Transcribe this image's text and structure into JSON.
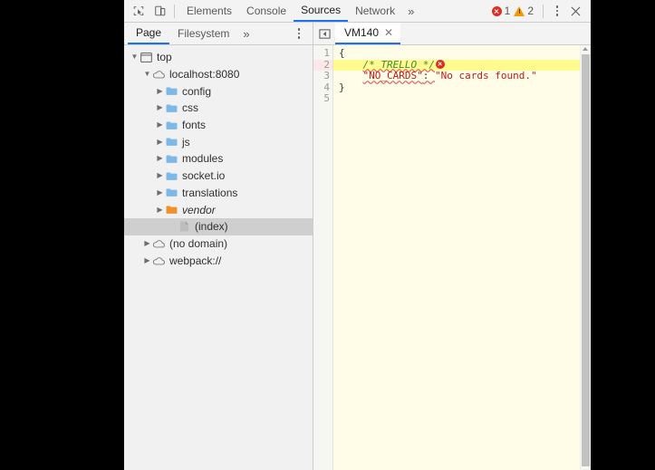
{
  "toolbar": {
    "inspect_icon": "inspect-cursor-icon",
    "device_icon": "device-toolbar-icon",
    "tabs": [
      {
        "label": "Elements",
        "active": false
      },
      {
        "label": "Console",
        "active": false
      },
      {
        "label": "Sources",
        "active": true
      },
      {
        "label": "Network",
        "active": false
      }
    ],
    "more_tabs_label": "»",
    "error_count": "1",
    "warning_count": "2",
    "menu_label": "⋮",
    "close_label": "✕"
  },
  "navigator": {
    "tabs": [
      {
        "label": "Page",
        "active": true
      },
      {
        "label": "Filesystem",
        "active": false
      }
    ],
    "more_tabs_label": "»",
    "menu_label": "⋮",
    "tree": [
      {
        "label": "top",
        "indent": 0,
        "twisty": "open",
        "icon": "frame-icon",
        "italic": false,
        "selected": false
      },
      {
        "label": "localhost:8080",
        "indent": 1,
        "twisty": "open",
        "icon": "cloud-icon",
        "italic": false,
        "selected": false
      },
      {
        "label": "config",
        "indent": 2,
        "twisty": "closed",
        "icon": "folder-icon",
        "italic": false,
        "selected": false
      },
      {
        "label": "css",
        "indent": 2,
        "twisty": "closed",
        "icon": "folder-icon",
        "italic": false,
        "selected": false
      },
      {
        "label": "fonts",
        "indent": 2,
        "twisty": "closed",
        "icon": "folder-icon",
        "italic": false,
        "selected": false
      },
      {
        "label": "js",
        "indent": 2,
        "twisty": "closed",
        "icon": "folder-icon",
        "italic": false,
        "selected": false
      },
      {
        "label": "modules",
        "indent": 2,
        "twisty": "closed",
        "icon": "folder-icon",
        "italic": false,
        "selected": false
      },
      {
        "label": "socket.io",
        "indent": 2,
        "twisty": "closed",
        "icon": "folder-icon",
        "italic": false,
        "selected": false
      },
      {
        "label": "translations",
        "indent": 2,
        "twisty": "closed",
        "icon": "folder-icon",
        "italic": false,
        "selected": false
      },
      {
        "label": "vendor",
        "indent": 2,
        "twisty": "closed",
        "icon": "folder-orange-icon",
        "italic": true,
        "selected": false
      },
      {
        "label": "(index)",
        "indent": 3,
        "twisty": "none",
        "icon": "document-icon",
        "italic": false,
        "selected": true
      },
      {
        "label": "(no domain)",
        "indent": 1,
        "twisty": "closed",
        "icon": "cloud-icon",
        "italic": false,
        "selected": false
      },
      {
        "label": "webpack://",
        "indent": 1,
        "twisty": "closed",
        "icon": "cloud-icon",
        "italic": false,
        "selected": false
      }
    ]
  },
  "editor": {
    "navigator_toggle_icon": "show-navigator-icon",
    "file_tab": {
      "label": "VM140",
      "close_label": "✕"
    },
    "line_numbers": [
      "1",
      "2",
      "3",
      "4",
      "5"
    ],
    "lines": [
      {
        "n": "1",
        "text": "{",
        "kind": "punctuation",
        "highlight": false,
        "error": false
      },
      {
        "n": "2",
        "text": "    /* TRELLO */",
        "kind": "comment",
        "highlight": true,
        "error": true
      },
      {
        "n": "3",
        "text": "    \"NO_CARDS\": \"No cards found.\"",
        "kind": "property",
        "highlight": false,
        "error": false
      },
      {
        "n": "4",
        "text": "}",
        "kind": "punctuation",
        "highlight": false,
        "error": false
      },
      {
        "n": "5",
        "text": "",
        "kind": "empty",
        "highlight": false,
        "error": false
      }
    ],
    "line3_key": "\"NO_CARDS\"",
    "line3_colon": ": ",
    "line3_value": "\"No cards found.\"",
    "line2_comment": "/* TRELLO */",
    "indent": "    "
  },
  "colors": {
    "accent": "#1a73e8",
    "error": "#d93025",
    "warning": "#f29900",
    "editor_bg": "#fffde7",
    "highlight_line": "#fffb8f",
    "comment": "#3a8c3a",
    "string": "#c41a16",
    "folder": "#7cb8e8",
    "folder_orange": "#f0922b",
    "selection": "#cfcfcf"
  }
}
